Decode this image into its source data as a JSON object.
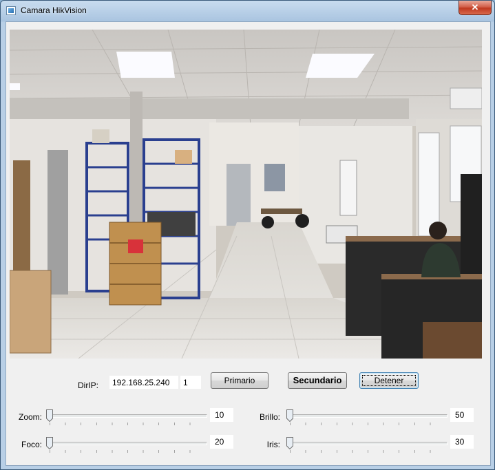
{
  "window": {
    "title": "Camara HikVision",
    "close_glyph": "✕"
  },
  "video": {
    "description_icon": "camera-feed"
  },
  "connection": {
    "ip_label": "DirIP:",
    "ip_value": "192.168.25.240",
    "channel_value": "1"
  },
  "buttons": {
    "primary": "Primario",
    "secondary": "Secundario",
    "stop": "Detener"
  },
  "controls": {
    "zoom": {
      "label": "Zoom:",
      "value": "10",
      "level": 0
    },
    "focus": {
      "label": "Foco:",
      "value": "20",
      "level": 0
    },
    "brightness": {
      "label": "Brillo:",
      "value": "50",
      "level": 0
    },
    "iris": {
      "label": "Iris:",
      "value": "30",
      "level": 0
    }
  }
}
